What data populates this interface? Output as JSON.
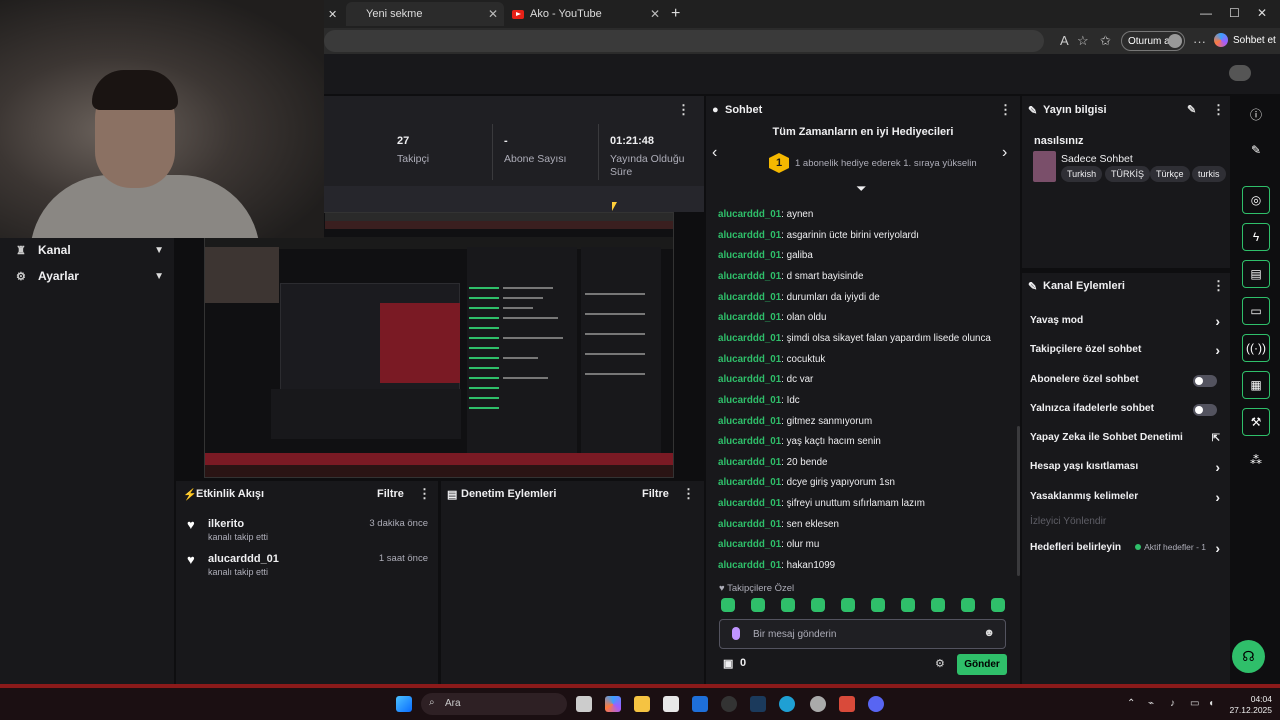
{
  "browser": {
    "tabs": [
      {
        "title": "Yeni sekme"
      },
      {
        "title": "Ako - YouTube"
      }
    ],
    "new_tab": "+",
    "login_label": "Oturum aç",
    "copilot_label": "Sohbet et",
    "more": "···",
    "win_min": "—",
    "win_max": "☐",
    "win_close": "✕"
  },
  "nav": {
    "items": [
      {
        "label": "Kanal",
        "icon": "channel-icon"
      },
      {
        "label": "Ayarlar",
        "icon": "gear-icon"
      }
    ]
  },
  "stats": {
    "followers_value": "27",
    "followers_label": "Takipçi",
    "subs_value": "-",
    "subs_label": "Abone Sayısı",
    "uptime_value": "01:21:48",
    "uptime_label": "Yayında Olduğu Süre"
  },
  "activity": {
    "title": "Etkinlik Akışı",
    "filter": "Filtre",
    "items": [
      {
        "name": "ilkerito",
        "sub": "kanalı takip etti",
        "time": "3 dakika önce"
      },
      {
        "name": "alucarddd_01",
        "sub": "kanalı takip etti",
        "time": "1 saat önce"
      }
    ]
  },
  "moderation": {
    "title": "Denetim Eylemleri",
    "filter": "Filtre"
  },
  "chat": {
    "title": "Sohbet",
    "gifters_title": "Tüm Zamanların en iyi Hediyecileri",
    "gifters_rank": "1",
    "gifters_text": "1 abonelik hediye ederek 1. sıraya yükselin",
    "messages": [
      {
        "user": "alucarddd_01",
        "text": "aynen"
      },
      {
        "user": "alucarddd_01",
        "text": "asgarinin ücte birini veriyolardı"
      },
      {
        "user": "alucarddd_01",
        "text": "galiba"
      },
      {
        "user": "alucarddd_01",
        "text": "d smart bayisinde"
      },
      {
        "user": "alucarddd_01",
        "text": "durumları da iyiydi de"
      },
      {
        "user": "alucarddd_01",
        "text": "olan oldu"
      },
      {
        "user": "alucarddd_01",
        "text": "şimdi olsa sikayet falan yapardım lisede olunca"
      },
      {
        "user": "alucarddd_01",
        "text": "cocuktuk"
      },
      {
        "user": "alucarddd_01",
        "text": "dc var"
      },
      {
        "user": "alucarddd_01",
        "text": "Idc"
      },
      {
        "user": "alucarddd_01",
        "text": "gitmez sanmıyorum"
      },
      {
        "user": "alucarddd_01",
        "text": "yaş kaçtı hacım senin"
      },
      {
        "user": "alucarddd_01",
        "text": "20 bende"
      },
      {
        "user": "alucarddd_01",
        "text": "dcye giriş yapıyorum 1sn"
      },
      {
        "user": "alucarddd_01",
        "text": "şifreyi unuttum sıfırlamam lazım"
      },
      {
        "user": "alucarddd_01",
        "text": "sen eklesen"
      },
      {
        "user": "alucarddd_01",
        "text": "olur mu"
      },
      {
        "user": "alucarddd_01",
        "text": "hakan1099"
      }
    ],
    "follower_only": "♥ Takipçilere Özel",
    "input_placeholder": "Bir mesaj gönderin",
    "points": "0",
    "send": "Gönder",
    "accent": "#2fbf6a"
  },
  "stream_info": {
    "title": "Yayın bilgisi",
    "stream_title": "nasılsınız",
    "category": "Sadece Sohbet",
    "tags": [
      "Turkish",
      "TÜRKİŞ",
      "Türkçe",
      "turkis"
    ]
  },
  "channel_actions": {
    "title": "Kanal Eylemleri",
    "items": [
      {
        "label": "Yavaş mod",
        "control": "chevron"
      },
      {
        "label": "Takipçilere özel sohbet",
        "control": "chevron"
      },
      {
        "label": "Abonelere özel sohbet",
        "control": "toggle-off"
      },
      {
        "label": "Yalnızca ifadelerle sohbet",
        "control": "toggle-off"
      },
      {
        "label": "Yapay Zeka ile Sohbet Denetimi",
        "control": "external"
      },
      {
        "label": "Hesap yaşı kısıtlaması",
        "control": "chevron"
      },
      {
        "label": "Yasaklanmış kelimeler",
        "control": "chevron"
      },
      {
        "label": "İzleyici Yönlendir",
        "control": "disabled"
      },
      {
        "label": "Hedefleri belirleyin",
        "control": "chevron"
      }
    ],
    "goals_badge": "Aktif hedefler - 1"
  },
  "taskbar": {
    "search": "Ara",
    "time": "04:04",
    "date": "27.12.2025"
  }
}
